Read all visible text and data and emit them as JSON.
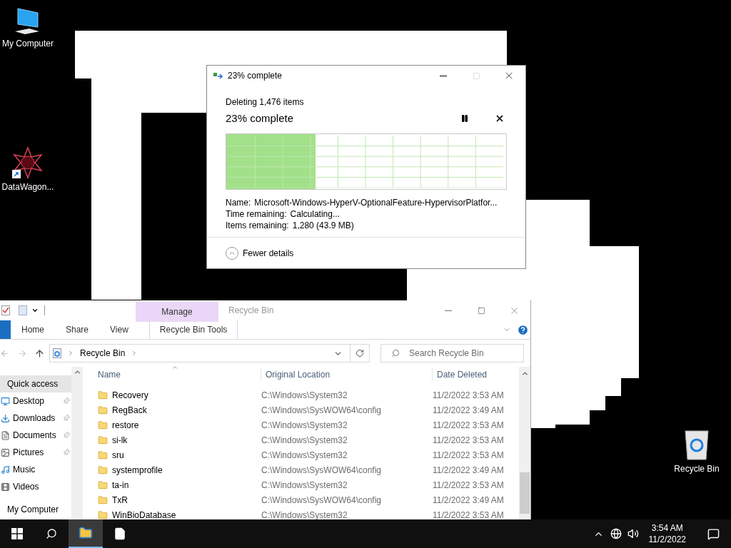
{
  "desktop_icons": [
    {
      "kind": "computer",
      "label": "My Computer"
    },
    {
      "kind": "shortcut",
      "label": "DataWagon..."
    },
    {
      "kind": "recycle-bin",
      "label": "Recycle Bin"
    }
  ],
  "progress_dialog": {
    "title": "23% complete",
    "heading": "Deleting 1,476 items",
    "status": "23% complete",
    "level": 0.32,
    "details": [
      {
        "label": "Name:",
        "value": "Microsoft-Windows-HyperV-OptionalFeature-HypervisorPlatfor..."
      },
      {
        "label": "Time remaining:",
        "value": "Calculating..."
      },
      {
        "label": "Items remaining:",
        "value": "1,280 (43.9 MB)"
      }
    ],
    "toggle": "Fewer details"
  },
  "explorer": {
    "title": "Recycle Bin",
    "contextual_tab": "Manage",
    "ribbon_tabs": [
      {
        "label": "Home",
        "selected": false
      },
      {
        "label": "Share",
        "selected": false
      },
      {
        "label": "View",
        "selected": false
      },
      {
        "label": "Recycle Bin Tools",
        "selected": false
      }
    ],
    "address": "Recycle Bin",
    "search": {
      "placeholder": "Search Recycle Bin"
    },
    "nav": [
      {
        "kind": "quick-access",
        "label": "Quick access",
        "selected": true,
        "pinned": false
      },
      {
        "kind": "desktop",
        "label": "Desktop",
        "selected": false,
        "pinned": true
      },
      {
        "kind": "downloads",
        "label": "Downloads",
        "selected": false,
        "pinned": true
      },
      {
        "kind": "documents",
        "label": "Documents",
        "selected": false,
        "pinned": true
      },
      {
        "kind": "pictures",
        "label": "Pictures",
        "selected": false,
        "pinned": true
      },
      {
        "kind": "music",
        "label": "Music",
        "selected": false,
        "pinned": false
      },
      {
        "kind": "videos",
        "label": "Videos",
        "selected": false,
        "pinned": false
      },
      {
        "kind": "computer",
        "label": "My Computer",
        "selected": false,
        "pinned": false
      }
    ],
    "columns": [
      "Name",
      "Original Location",
      "Date Deleted"
    ],
    "rows": [
      [
        "Recovery",
        "C:\\Windows\\System32",
        "11/2/2022 3:53 AM"
      ],
      [
        "RegBack",
        "C:\\Windows\\SysWOW64\\config",
        "11/2/2022 3:49 AM"
      ],
      [
        "restore",
        "C:\\Windows\\System32",
        "11/2/2022 3:53 AM"
      ],
      [
        "si-lk",
        "C:\\Windows\\System32",
        "11/2/2022 3:53 AM"
      ],
      [
        "sru",
        "C:\\Windows\\System32",
        "11/2/2022 3:53 AM"
      ],
      [
        "systemprofile",
        "C:\\Windows\\SysWOW64\\config",
        "11/2/2022 3:49 AM"
      ],
      [
        "ta-in",
        "C:\\Windows\\System32",
        "11/2/2022 3:53 AM"
      ],
      [
        "TxR",
        "C:\\Windows\\SysWOW64\\config",
        "11/2/2022 3:49 AM"
      ],
      [
        "WinBioDatabase",
        "C:\\Windows\\System32",
        "11/2/2022 3:53 AM"
      ]
    ]
  },
  "taskbar": {
    "apps": [
      {
        "kind": "explorer",
        "selected": true
      },
      {
        "kind": "document",
        "selected": false
      }
    ],
    "time": "3:54 AM",
    "date": "11/2/2022"
  }
}
